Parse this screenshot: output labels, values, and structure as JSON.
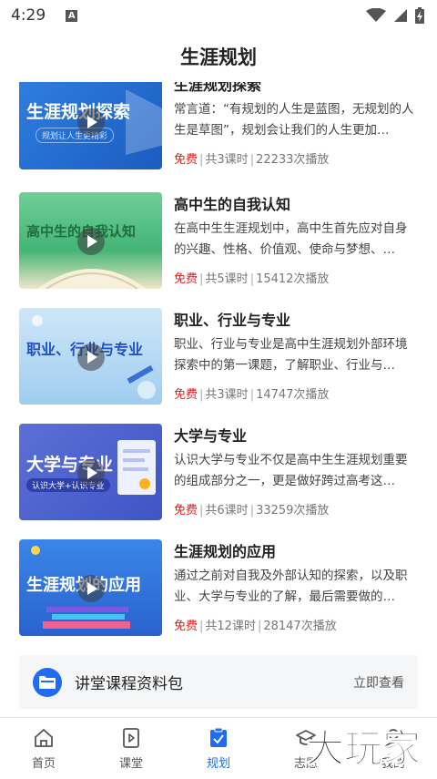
{
  "status": {
    "time": "4:29"
  },
  "header": {
    "title": "生涯规划"
  },
  "courses": [
    {
      "title": "生涯规划探索",
      "thumb_text": "生涯规划探索",
      "thumb_sub": "规划让人生更精彩",
      "desc": "常言道：“有规划的人生是蓝图，无规划的人生是草图”，规划会让我们的人生更加…",
      "price": "免费",
      "lessons": "共3课时",
      "plays": "22233次播放"
    },
    {
      "title": "高中生的自我认知",
      "thumb_text": "高中生的自我认知",
      "desc": "在高中生生涯规划中，高中生首先应对自身的兴趣、性格、价值观、使命与梦想、…",
      "price": "免费",
      "lessons": "共5课时",
      "plays": "15412次播放"
    },
    {
      "title": "职业、行业与专业",
      "thumb_text": "职业、行业与专业",
      "desc": "职业、行业与专业是高中生涯规划外部环境探索中的第一课题，了解职业、行业与…",
      "price": "免费",
      "lessons": "共3课时",
      "plays": "14747次播放"
    },
    {
      "title": "大学与专业",
      "thumb_text": "大学与专业",
      "thumb_sub": "认识大学+认识专业",
      "desc": "认识大学与专业不仅是高中生生涯规划重要的组成部分之一，更是做好跨过高考这…",
      "price": "免费",
      "lessons": "共6课时",
      "plays": "33259次播放"
    },
    {
      "title": "生涯规划的应用",
      "thumb_text": "生涯规划的应用",
      "desc": "通过之前对自我及外部认知的探索，以及职业、大学与专业的了解，最后需要做的…",
      "price": "免费",
      "lessons": "共12课时",
      "plays": "28147次播放"
    }
  ],
  "package": {
    "title": "讲堂课程资料包",
    "link": "立即查看"
  },
  "tabs": [
    {
      "label": "首页",
      "icon": "home-icon"
    },
    {
      "label": "课堂",
      "icon": "play-doc-icon"
    },
    {
      "label": "规划",
      "icon": "clipboard-check-icon",
      "active": true
    },
    {
      "label": "志愿",
      "icon": "cap-icon"
    },
    {
      "label": "我的",
      "icon": "user-icon"
    }
  ],
  "watermark": "大玩家",
  "colors": {
    "accent": "#1f6bf3",
    "free": "#e02020"
  }
}
